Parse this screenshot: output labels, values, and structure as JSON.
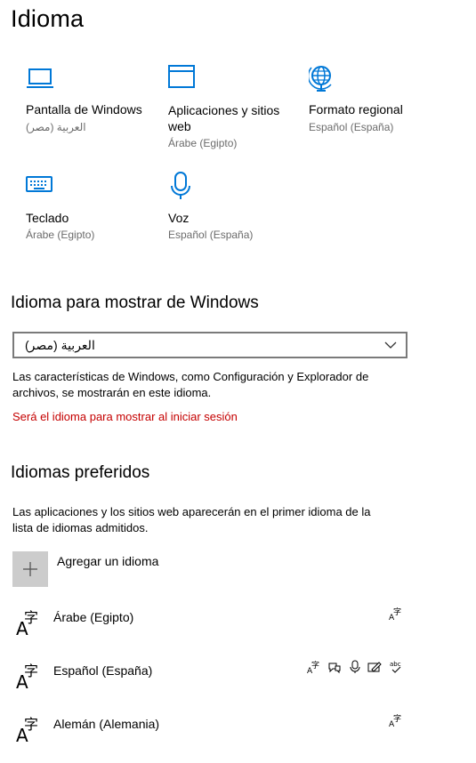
{
  "page": {
    "title": "Idioma"
  },
  "tiles": [
    {
      "id": "display",
      "label": "Pantalla de Windows",
      "sub": "العربية (مصر)"
    },
    {
      "id": "apps",
      "label": "Aplicaciones y sitios web",
      "label_line1": "Aplicaciones y sitios",
      "label_line2": "web",
      "sub": "Árabe (Egipto)"
    },
    {
      "id": "regional",
      "label": "Formato regional",
      "sub": "Español (España)"
    },
    {
      "id": "keyboard",
      "label": "Teclado",
      "sub": "Árabe (Egipto)"
    },
    {
      "id": "voice",
      "label": "Voz",
      "sub": "Español (España)"
    }
  ],
  "display_language": {
    "heading": "Idioma para mostrar de Windows",
    "selected": "العربية (مصر)",
    "description_line1": "Las características de Windows, como Configuración y Explorador de",
    "description_line2": "archivos, se mostrarán en este idioma.",
    "warning": "Será el idioma para mostrar al iniciar sesión"
  },
  "preferred": {
    "heading": "Idiomas preferidos",
    "description_line1": "Las aplicaciones y los sitios web aparecerán en el primer idioma de la",
    "description_line2": "lista de idiomas admitidos.",
    "add_label": "Agregar un idioma",
    "languages": [
      {
        "name": "Árabe (Egipto)",
        "features": [
          "display-language-icon"
        ]
      },
      {
        "name": "Español (España)",
        "features": [
          "display-language-icon",
          "speech-icon",
          "microphone-icon",
          "handwriting-icon",
          "spellcheck-icon"
        ]
      },
      {
        "name": "Alemán (Alemania)",
        "features": [
          "display-language-icon"
        ]
      }
    ]
  },
  "colors": {
    "accent": "#0078d7",
    "warning": "#c50000",
    "secondary_text": "#6b6b6b",
    "add_button_bg": "#cccccc"
  }
}
